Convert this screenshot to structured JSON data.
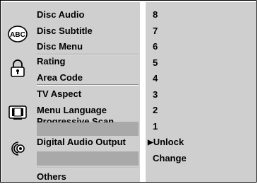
{
  "menu": {
    "groups": [
      {
        "icon": "disc-abc-icon",
        "items": [
          "Disc Audio",
          "Disc Subtitle",
          "Disc Menu"
        ]
      },
      {
        "icon": "padlock-icon",
        "items": [
          "Rating",
          "Area Code"
        ]
      },
      {
        "icon": "tv-screen-icon",
        "items": [
          "TV Aspect",
          "Menu Language",
          "Progressive Scan"
        ]
      },
      {
        "icon": "speaker-audio-icon",
        "items": [
          "Digital Audio Output"
        ]
      }
    ],
    "others_label": "Others"
  },
  "rating_options": [
    "8",
    "7",
    "6",
    "5",
    "4",
    "3",
    "2",
    "1"
  ],
  "actions": {
    "unlock_marker": "▶",
    "unlock_label": "Unlock",
    "change_label": "Change"
  },
  "selected_item": "Rating"
}
